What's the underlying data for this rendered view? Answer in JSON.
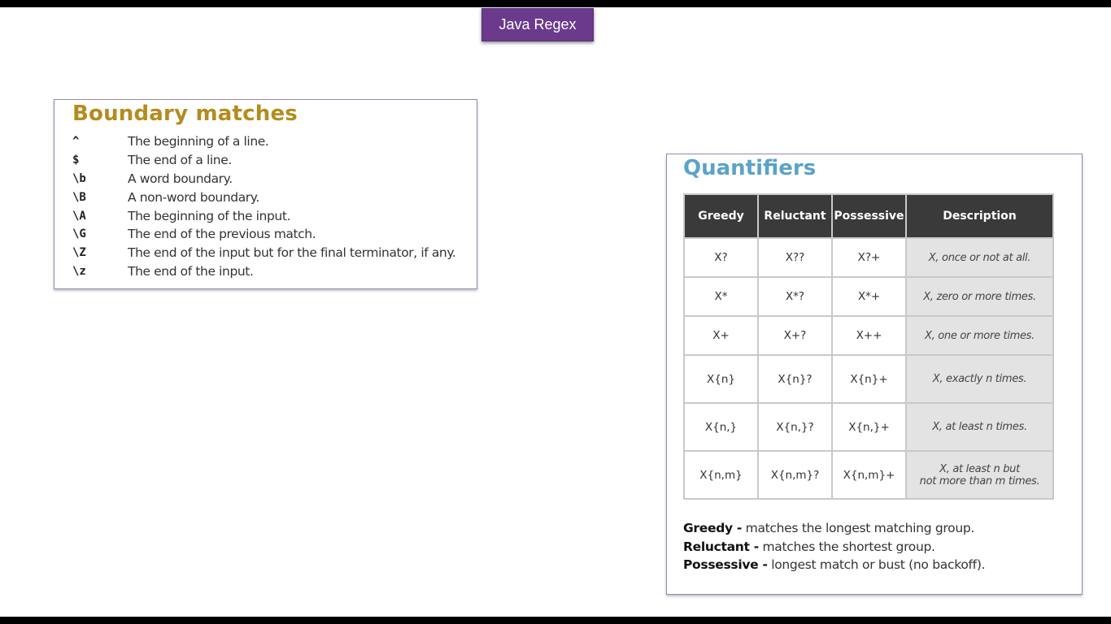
{
  "slide": {
    "title": "Java Regex"
  },
  "boundary": {
    "heading": "Boundary matches",
    "items": [
      {
        "code": "^",
        "desc": "The beginning of a line."
      },
      {
        "code": "$",
        "desc": "The end of a line."
      },
      {
        "code": "\\b",
        "desc": "A word boundary."
      },
      {
        "code": "\\B",
        "desc": "A non-word boundary."
      },
      {
        "code": "\\A",
        "desc": "The beginning of the input."
      },
      {
        "code": "\\G",
        "desc": "The end of the previous match."
      },
      {
        "code": "\\Z",
        "desc": "The end of the input but for the final terminator, if any."
      },
      {
        "code": "\\z",
        "desc": "The end of the input."
      }
    ]
  },
  "quantifiers": {
    "heading": "Quantifiers",
    "headers": [
      "Greedy",
      "Reluctant",
      "Possessive",
      "Description"
    ],
    "rows": [
      {
        "greedy": "X?",
        "reluctant": "X??",
        "possessive": "X?+",
        "desc": "X, once or not at all."
      },
      {
        "greedy": "X*",
        "reluctant": "X*?",
        "possessive": "X*+",
        "desc": "X, zero or more times."
      },
      {
        "greedy": "X+",
        "reluctant": "X+?",
        "possessive": "X++",
        "desc": "X, one or more times."
      },
      {
        "greedy": "X{n}",
        "reluctant": "X{n}?",
        "possessive": "X{n}+",
        "desc": "X, exactly n times."
      },
      {
        "greedy": "X{n,}",
        "reluctant": "X{n,}?",
        "possessive": "X{n,}+",
        "desc": "X, at least n times."
      },
      {
        "greedy": "X{n,m}",
        "reluctant": "X{n,m}?",
        "possessive": "X{n,m}+",
        "desc_line1": "X, at least n but",
        "desc_line2": "not more than m times."
      }
    ],
    "legend": [
      {
        "term": "Greedy -",
        "text": " matches the longest matching group."
      },
      {
        "term": "Reluctant -",
        "text": " matches the shortest group."
      },
      {
        "term": "Possessive -",
        "text": " longest match or bust (no backoff)."
      }
    ]
  },
  "colors": {
    "title_bg": "#6b3a8d",
    "boundary_heading": "#b48c1d",
    "quant_heading": "#5aa3c8",
    "table_header_bg": "#3a3a3a",
    "desc_cell_bg": "#e3e3e3"
  }
}
